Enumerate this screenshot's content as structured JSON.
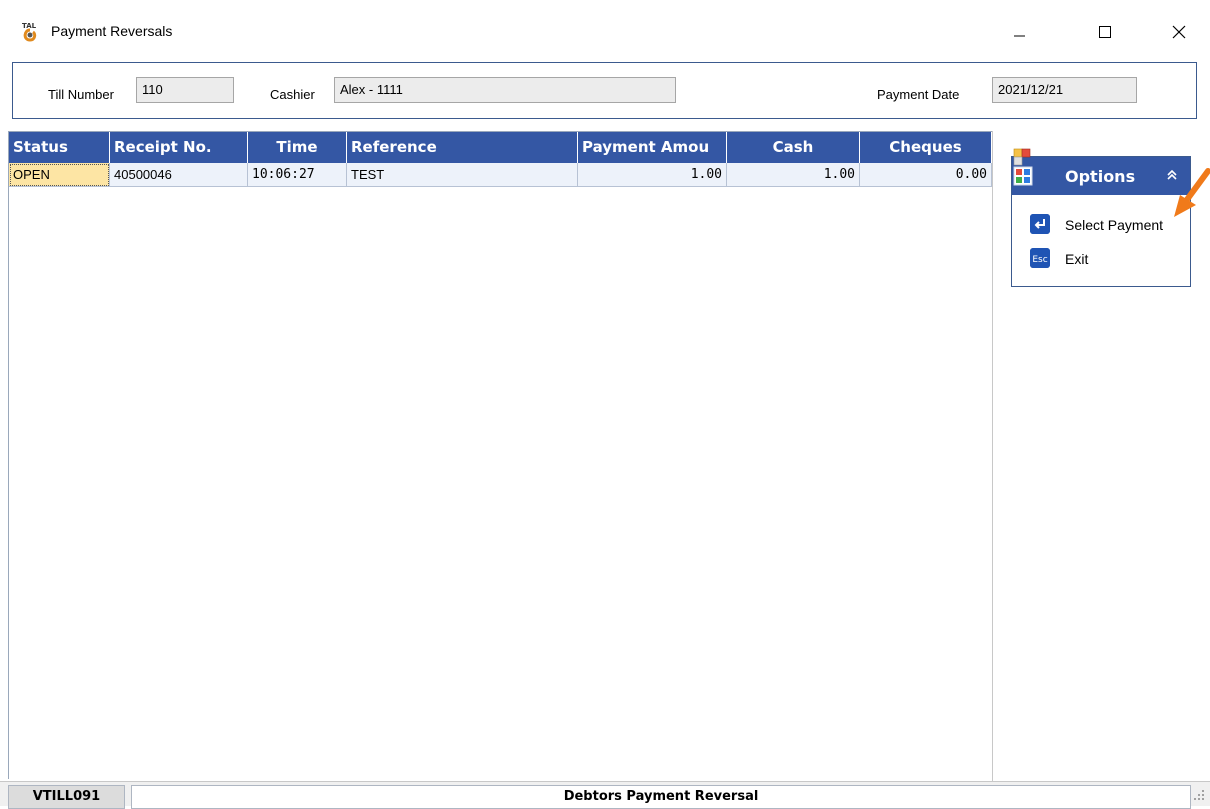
{
  "window": {
    "title": "Payment Reversals",
    "controls": {
      "minimize": "minimize-icon",
      "maximize": "maximize-icon",
      "close": "close-icon"
    }
  },
  "header": {
    "till_label": "Till Number",
    "till_value": "110",
    "cashier_label": "Cashier",
    "cashier_value": "Alex - 1111",
    "date_label": "Payment Date",
    "date_value": "2021/12/21"
  },
  "grid": {
    "columns": [
      "Status",
      "Receipt No.",
      "Time",
      "Reference",
      "Payment Amou",
      "Cash",
      "Cheques"
    ],
    "rows": [
      {
        "status": "OPEN",
        "receipt": "40500046",
        "time": "10:06:27",
        "reference": "TEST",
        "amount": "1.00",
        "cash": "1.00",
        "cheques": "0.00"
      }
    ]
  },
  "options": {
    "title": "Options",
    "items": [
      {
        "label": "Select Payment",
        "icon": "enter-key-icon"
      },
      {
        "label": "Exit",
        "icon": "esc-key-icon"
      }
    ]
  },
  "status_bar": {
    "code": "VTILL091",
    "title": "Debtors Payment Reversal"
  },
  "colors": {
    "header_blue": "#3457a4",
    "status_highlight": "#fde5a4",
    "arrow_orange": "#f07a1a"
  }
}
